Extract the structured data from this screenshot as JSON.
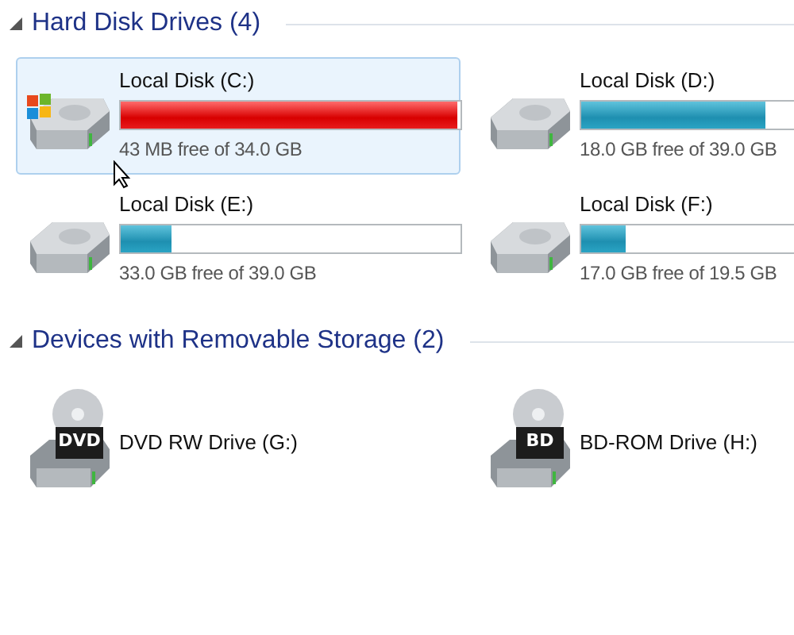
{
  "sections": [
    {
      "title": "Hard Disk Drives (4)",
      "expanded": true,
      "items": [
        {
          "kind": "system",
          "name": "Local Disk (C:)",
          "level": 0.99,
          "low_space": true,
          "free": "43 MB free of 34.0 GB",
          "selected": true
        },
        {
          "kind": "disk",
          "name": "Local Disk (D:)",
          "level": 0.54,
          "low_space": false,
          "free": "18.0 GB free of 39.0 GB",
          "selected": false
        },
        {
          "kind": "disk",
          "name": "Local Disk (E:)",
          "level": 0.15,
          "low_space": false,
          "free": "33.0 GB free of 39.0 GB",
          "selected": false
        },
        {
          "kind": "disk",
          "name": "Local Disk (F:)",
          "level": 0.13,
          "low_space": false,
          "free": "17.0 GB free of 19.5 GB",
          "selected": false
        }
      ]
    },
    {
      "title": "Devices with Removable Storage (2)",
      "expanded": true,
      "items": [
        {
          "kind": "optical",
          "badge": "DVD",
          "name": "DVD RW Drive (G:)"
        },
        {
          "kind": "optical",
          "badge": "BD",
          "name": "BD-ROM Drive (H:)"
        }
      ]
    }
  ]
}
